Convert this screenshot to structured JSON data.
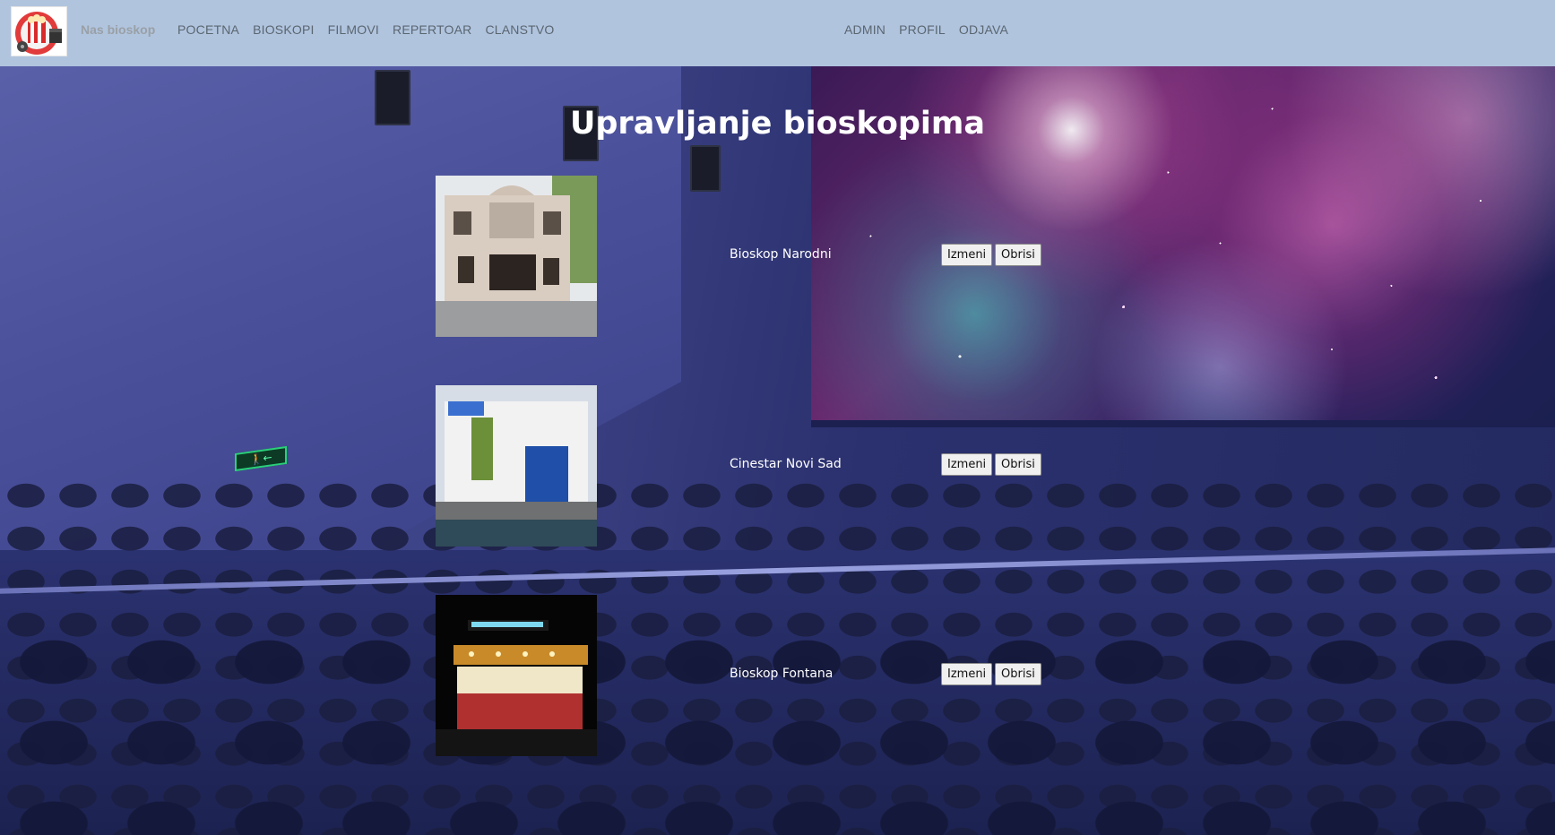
{
  "nav": {
    "brand": "Nas bioskop",
    "left_links": [
      "POCETNA",
      "BIOSKOPI",
      "FILMOVI",
      "REPERTOAR",
      "CLANSTVO"
    ],
    "right_links": [
      "ADMIN",
      "PROFIL",
      "ODJAVA"
    ]
  },
  "page": {
    "title": "Upravljanje bioskopima"
  },
  "cinemas": [
    {
      "name": "Bioskop Narodni",
      "edit_label": "Izmeni",
      "delete_label": "Obrisi"
    },
    {
      "name": "Cinestar Novi Sad",
      "edit_label": "Izmeni",
      "delete_label": "Obrisi"
    },
    {
      "name": "Bioskop Fontana",
      "edit_label": "Izmeni",
      "delete_label": "Obrisi"
    }
  ],
  "colors": {
    "navbar": "#b0c4de",
    "nav_link": "#5b6670",
    "brand": "#9aa0a6",
    "title": "#ffffff"
  }
}
